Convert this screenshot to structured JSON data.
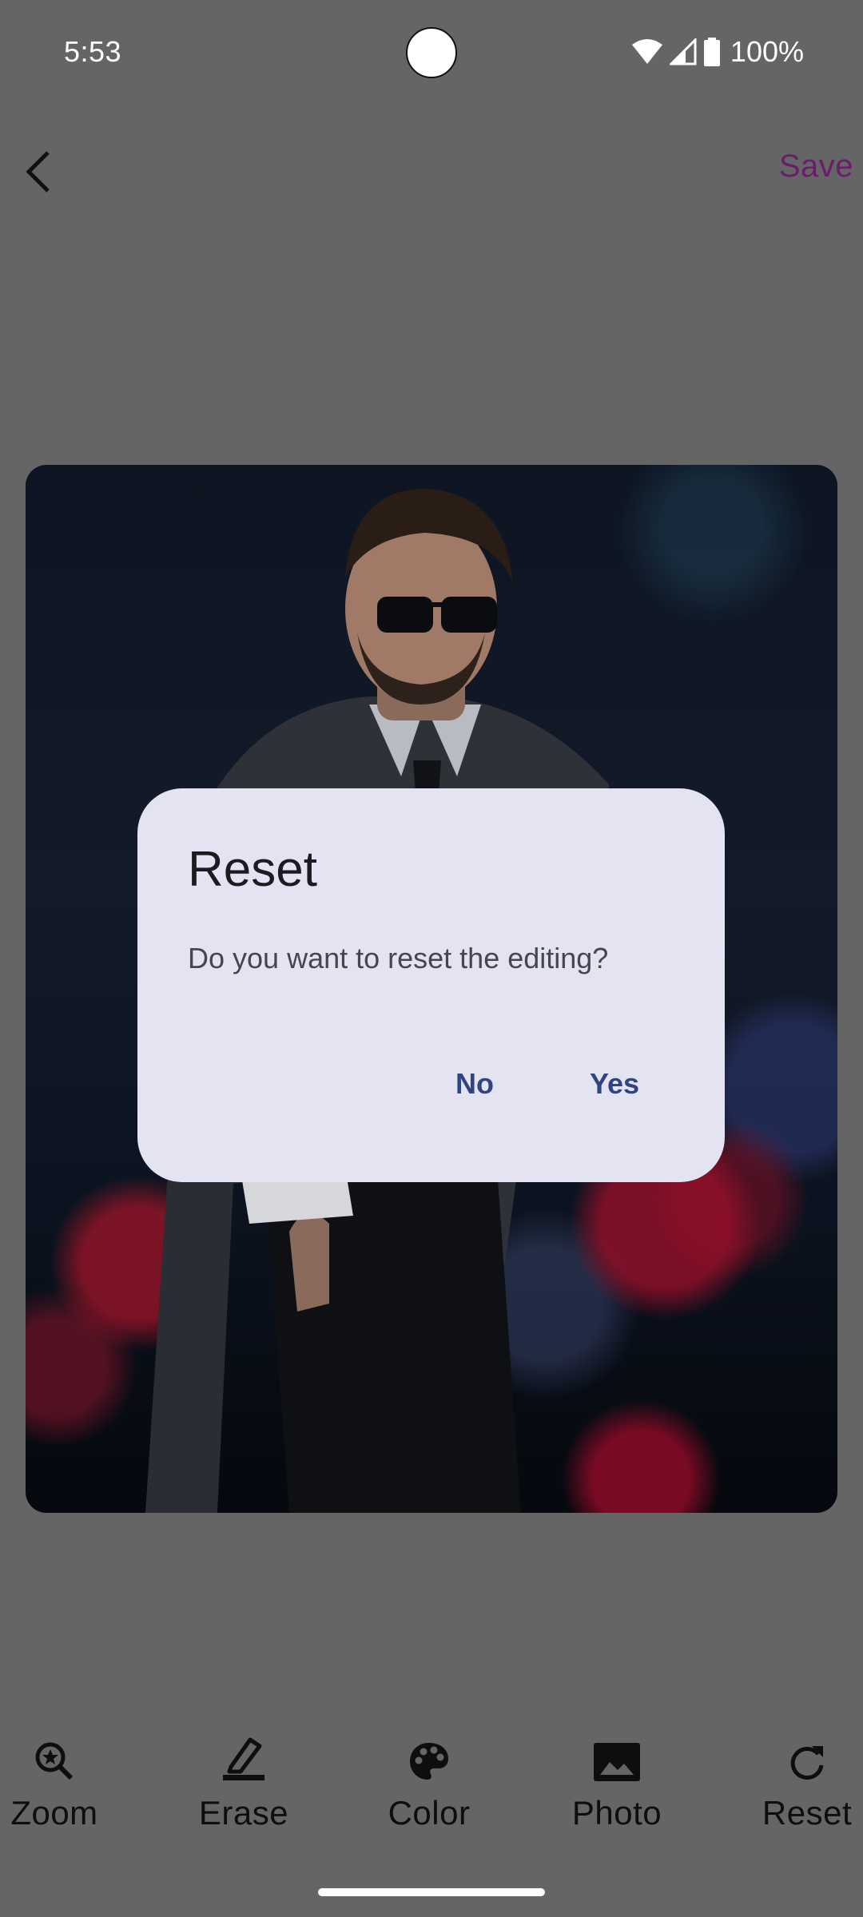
{
  "status_bar": {
    "time": "5:53",
    "battery": "100%",
    "icons": [
      "wifi-icon",
      "signal-icon",
      "battery-icon"
    ]
  },
  "top_bar": {
    "back_icon": "back-arrow-icon",
    "save_label": "Save",
    "save_color": "#6a1d6a"
  },
  "dialog": {
    "title": "Reset",
    "message": "Do you want to reset the editing?",
    "no_label": "No",
    "yes_label": "Yes",
    "background": "#e4e3f1",
    "button_color": "#2f4481"
  },
  "toolbar": {
    "tools": [
      {
        "label": "Zoom",
        "icon": "zoom-icon"
      },
      {
        "label": "Erase",
        "icon": "erase-icon"
      },
      {
        "label": "Color",
        "icon": "palette-icon"
      },
      {
        "label": "Photo",
        "icon": "photo-icon"
      },
      {
        "label": "Reset",
        "icon": "reset-icon"
      }
    ]
  }
}
